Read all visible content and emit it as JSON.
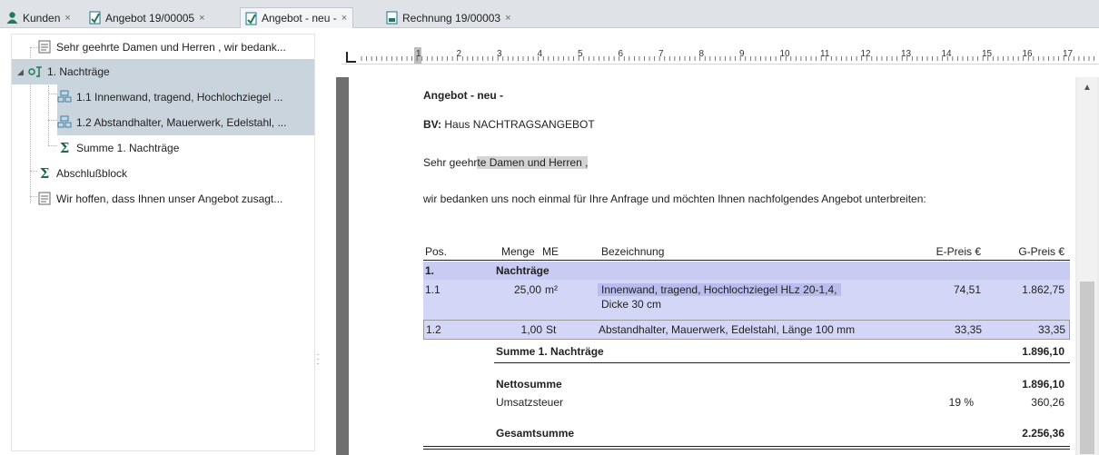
{
  "tabs": [
    {
      "label": "Kunden",
      "icon": "customer-icon",
      "active": false
    },
    {
      "label": "Angebot 19/00005",
      "icon": "offer-document-icon",
      "active": false
    },
    {
      "label": "Angebot - neu -",
      "icon": "offer-document-icon",
      "active": true
    },
    {
      "label": "Rechnung 19/00003",
      "icon": "invoice-document-icon",
      "active": false
    }
  ],
  "tab_close_glyph": "×",
  "tree": {
    "items": [
      {
        "label": "Sehr geehrte Damen und Herren , wir bedank...",
        "icon": "text-block-icon"
      },
      {
        "label": "1. Nachträge",
        "icon": "title-group-icon"
      },
      {
        "label": "1.1 Innenwand, tragend, Hochlochziegel ...",
        "icon": "position-icon"
      },
      {
        "label": "1.2 Abstandhalter, Mauerwerk, Edelstahl, ...",
        "icon": "position-icon"
      },
      {
        "label": "Summe 1. Nachträge",
        "icon": "sum-icon"
      },
      {
        "label": "Abschlußblock",
        "icon": "sum-icon"
      },
      {
        "label": "Wir hoffen, dass Ihnen unser Angebot zusagt...",
        "icon": "text-block-icon"
      }
    ]
  },
  "document": {
    "heading": "Angebot - neu -",
    "bv_label": "BV:",
    "bv_value": "Haus NACHTRAGSANGEBOT",
    "salutation_plain": "Sehr geehr",
    "salutation_hl": "te Damen und Herren  ,",
    "intro": "wir bedanken uns noch einmal für Ihre Anfrage und möchten Ihnen nachfolgendes Angebot unterbreiten:",
    "table": {
      "headers": {
        "pos": "Pos.",
        "menge": "Menge",
        "me": "ME",
        "bez": "Bezeichnung",
        "epreis": "E-Preis €",
        "gpreis": "G-Preis €"
      },
      "group": {
        "pos": "1.",
        "title": "Nachträge"
      },
      "rows": [
        {
          "pos": "1.1",
          "menge": "25,00",
          "me": "m²",
          "bez1": "Innenwand, tragend, Hochlochziegel HLz 20-1,4,",
          "bez2": "Dicke 30 cm",
          "epreis": "74,51",
          "gpreis": "1.862,75"
        },
        {
          "pos": "1.2",
          "menge": "1,00",
          "me": "St",
          "bez1": "Abstandhalter, Mauerwerk, Edelstahl, Länge 100 mm",
          "bez2": "",
          "epreis": "33,35",
          "gpreis": "33,35"
        }
      ],
      "subtotal": {
        "label": "Summe 1. Nachträge",
        "value": "1.896,10"
      },
      "netto": {
        "label": "Nettosumme",
        "value": "1.896,10"
      },
      "ust": {
        "label": "Umsatzsteuer",
        "rate": "19 %",
        "value": "360,26"
      },
      "gesamt": {
        "label": "Gesamtsumme",
        "value": "2.256,36"
      }
    }
  },
  "ruler": {
    "numbers": [
      "1",
      "2",
      "3",
      "4",
      "5",
      "6",
      "7",
      "8",
      "9",
      "10",
      "11",
      "12",
      "13",
      "14",
      "15",
      "16",
      "17"
    ]
  },
  "colors": {
    "selection": "#c9d4dc",
    "row_highlight": "#c8ccf2",
    "accent_green": "#1c6c54"
  }
}
